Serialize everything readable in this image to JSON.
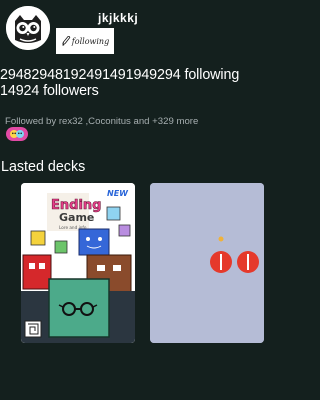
{
  "profile": {
    "username": "jkjkkkj",
    "follow_button_label": "following",
    "following_line": "2948294819249149194929​4 following",
    "followers_line": "14924 followers",
    "followed_by": "Followed by rex32 ,Coconitus and +329 more"
  },
  "decks_section": {
    "title": "Lasted decks",
    "decks": [
      {
        "title_line1": "Ending",
        "title_line2": "Game",
        "subtitle": "Lore and info",
        "badge": "NEW"
      },
      {}
    ]
  },
  "colors": {
    "background": "#14201e",
    "accent_pink": "#e24aa5",
    "deck2_bg": "#b5bcd6",
    "deck2_icon": "#e5392b"
  },
  "icons": [
    "owl-avatar-icon",
    "pencil-icon",
    "emoji-badge-icon",
    "spectacles-icon"
  ]
}
